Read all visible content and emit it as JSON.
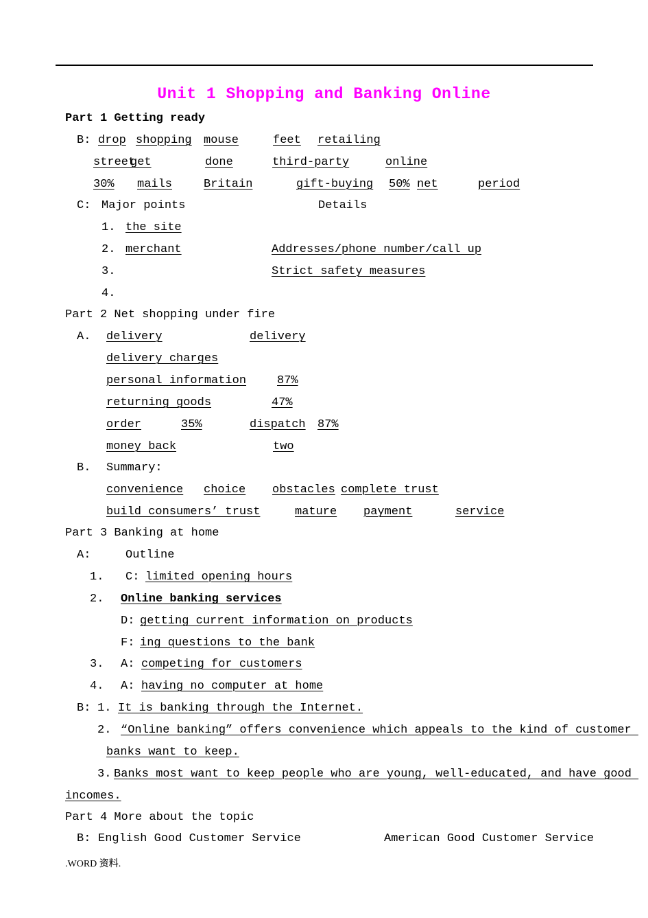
{
  "document": {
    "title": "Unit 1 Shopping and Banking Online",
    "title_color": "#ff00ff",
    "footer": ".WORD 资料."
  },
  "part1": {
    "heading": "Part 1 Getting ready",
    "b_label": "B:",
    "b_row1": [
      "drop",
      "shopping",
      "mouse",
      "feet",
      "retailing"
    ],
    "b_row2": [
      "street",
      "get",
      "done",
      "third-party",
      "online"
    ],
    "b_row3": [
      "30%",
      "mails",
      "Britain",
      "gift-buying",
      "50%",
      "net",
      "period"
    ],
    "c_label": "C:",
    "c_col_major": "Major points",
    "c_col_details": "Details",
    "c_rows": [
      {
        "num": "1.",
        "major": "the site",
        "details": ""
      },
      {
        "num": "2.",
        "major": "merchant",
        "details": "Addresses/phone number/call up"
      },
      {
        "num": "3.",
        "major": "",
        "details": "Strict safety measures"
      },
      {
        "num": "4.",
        "major": "",
        "details": ""
      }
    ]
  },
  "part2": {
    "heading": "Part 2 Net shopping under fire",
    "a_label": "A.",
    "a_rows": [
      {
        "left": "delivery",
        "mid": "delivery",
        "right": ""
      },
      {
        "left": "delivery charges",
        "mid": "",
        "right": ""
      },
      {
        "left": "personal information",
        "mid": "87%",
        "right": ""
      },
      {
        "left": "returning goods",
        "mid": "47%",
        "right": ""
      },
      {
        "left": "order",
        "mid2": "35%",
        "mid": "dispatch",
        "right": "87%"
      },
      {
        "left": "money back",
        "mid": "two",
        "right": ""
      }
    ],
    "b_label": "B.",
    "b_heading": "Summary:",
    "b_row1": [
      "convenience",
      "choice",
      "obstacles",
      "complete trust"
    ],
    "b_row2": [
      "build consumers’ trust",
      "mature",
      "payment",
      "service"
    ]
  },
  "part3": {
    "heading": "Part 3 Banking at home",
    "a_label": "A:",
    "a_title": "Outline",
    "items": [
      {
        "num": "1.",
        "tag": "C:",
        "text": "limited opening hours",
        "bold": false
      },
      {
        "num": "2.",
        "tag": "",
        "text": "Online banking services",
        "bold": true
      },
      {
        "num": "",
        "tag": "D:",
        "text": "getting current information on products",
        "bold": false
      },
      {
        "num": "",
        "tag": "F:",
        "text": "ing questions to the bank",
        "bold": false
      },
      {
        "num": "3.",
        "tag": "A:",
        "text": "competing for customers",
        "bold": false
      },
      {
        "num": "4.",
        "tag": "A:",
        "text": "having no computer at home",
        "bold": false
      }
    ],
    "b_label": "B:",
    "b_items": [
      {
        "num": "1.",
        "text": "It is banking through the Internet."
      },
      {
        "num": "2.",
        "line1": "“Online banking” offers convenience which appeals to the kind of customer ",
        "line2": "banks want to keep."
      },
      {
        "num": "3.",
        "line1": "Banks most want to keep people who are young, well-educated, and have good ",
        "line2": "incomes."
      }
    ]
  },
  "part4": {
    "heading": "Part 4 More about the topic",
    "b_label": "B:",
    "col_left": "English Good Customer Service",
    "col_right": "American Good Customer Service"
  }
}
